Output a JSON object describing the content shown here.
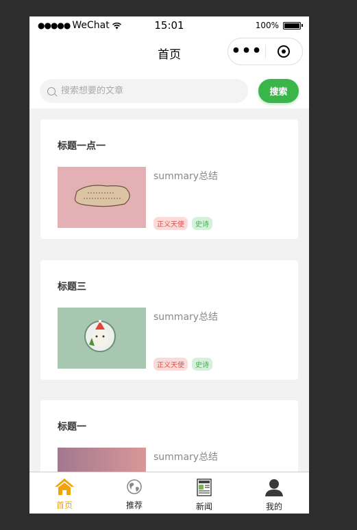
{
  "status_bar": {
    "carrier": "WeChat",
    "time": "15:01",
    "battery": "100%"
  },
  "nav": {
    "title": "首页"
  },
  "search": {
    "placeholder": "搜索想要的文章",
    "button_label": "搜索"
  },
  "articles": [
    {
      "title": "标题一点一",
      "summary": "summary总结",
      "tags": [
        "正义天使",
        "史诗"
      ]
    },
    {
      "title": "标题三",
      "summary": "summary总结",
      "tags": [
        "正义天使",
        "史诗"
      ]
    },
    {
      "title": "标题一",
      "summary": "summary总结",
      "tags": []
    }
  ],
  "tabs": [
    {
      "label": "首页",
      "icon": "home-icon",
      "active": true
    },
    {
      "label": "推荐",
      "icon": "globe-icon",
      "active": false
    },
    {
      "label": "新闻",
      "icon": "newspaper-icon",
      "active": false
    },
    {
      "label": "我的",
      "icon": "user-icon",
      "active": false
    }
  ],
  "colors": {
    "accent_green": "#39b54a",
    "tab_active": "#f0a30a",
    "tag_red": "#e54d42"
  }
}
